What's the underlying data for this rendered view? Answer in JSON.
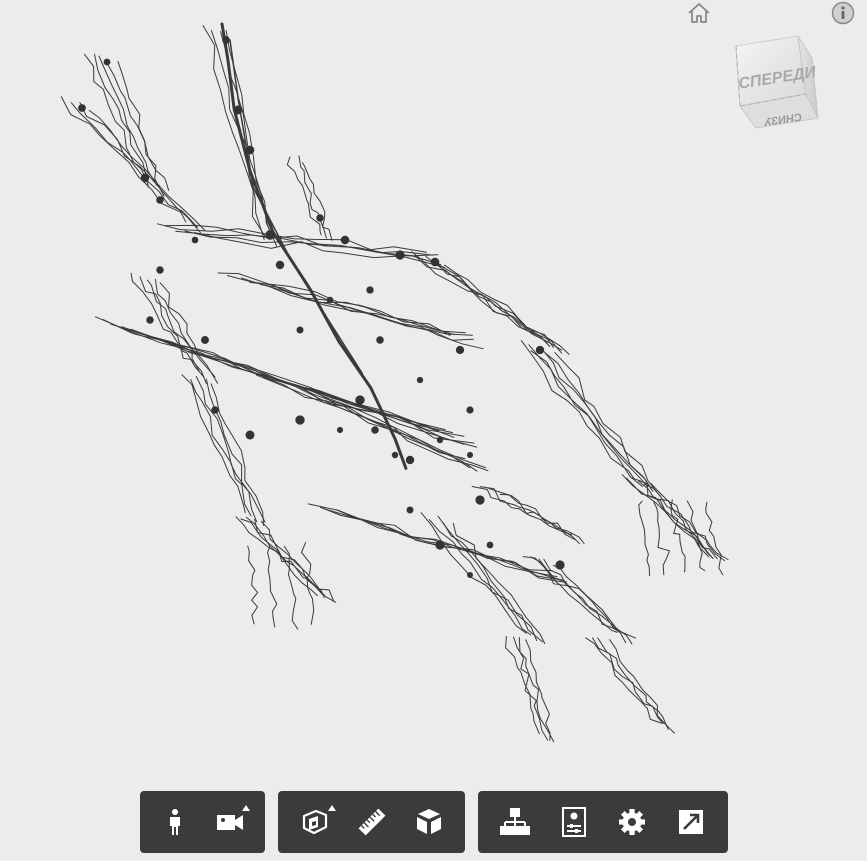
{
  "viewcube": {
    "front_label": "СПЕРЕДИ",
    "bottom_label": "СНИЗУ"
  },
  "top_icons": [
    "home-icon",
    "info-icon"
  ],
  "toolbar": {
    "groups": [
      [
        "first-person-icon",
        "camera-icon"
      ],
      [
        "section-icon",
        "measure-icon",
        "explode-icon"
      ],
      [
        "model-tree-icon",
        "properties-icon",
        "settings-icon",
        "fullscreen-icon"
      ]
    ]
  },
  "colors": {
    "background": "#ececec",
    "toolbar": "#3b3b3b",
    "toolbar_icon": "#ffffff",
    "model": "#3a3a3a"
  }
}
